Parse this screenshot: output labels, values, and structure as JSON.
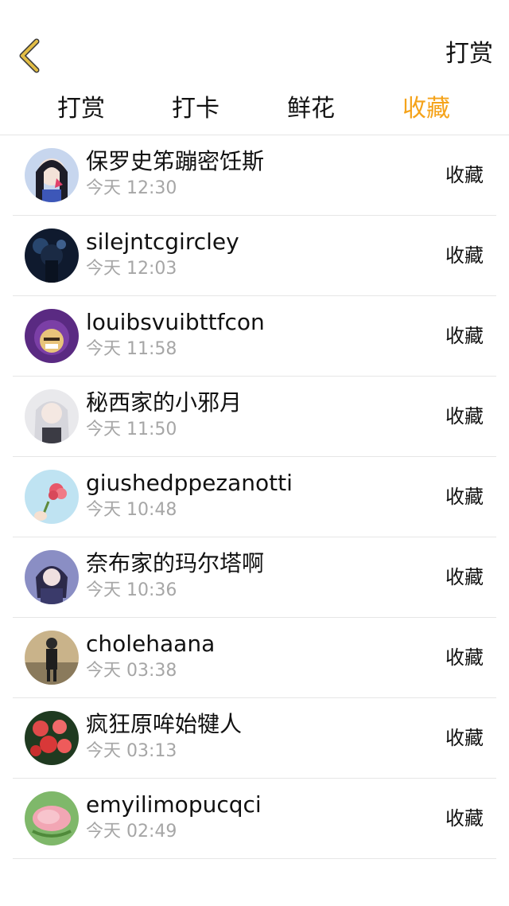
{
  "header": {
    "title": "打赏",
    "back_icon": "chevron-left-icon",
    "back_icon_color": "#d9b23b"
  },
  "tabs": [
    {
      "label": "打赏",
      "active": false
    },
    {
      "label": "打卡",
      "active": false
    },
    {
      "label": "鲜花",
      "active": false
    },
    {
      "label": "收藏",
      "active": true
    }
  ],
  "colors": {
    "active_tab": "#f5a31a",
    "text": "#111111",
    "secondary_text": "#a6a6a6",
    "divider": "#e6e6e6"
  },
  "list": [
    {
      "name": "保罗史笫蹦密饪斯",
      "time": "今天 12:30",
      "action": "收藏"
    },
    {
      "name": "silejntcgircley",
      "time": "今天 12:03",
      "action": "收藏"
    },
    {
      "name": "louibsvuibttfcon",
      "time": "今天 11:58",
      "action": "收藏"
    },
    {
      "name": "秘西家的小邪月",
      "time": "今天 11:50",
      "action": "收藏"
    },
    {
      "name": "giushedppezanotti",
      "time": "今天 10:48",
      "action": "收藏"
    },
    {
      "name": "奈布家的玛尔塔啊",
      "time": "今天 10:36",
      "action": "收藏"
    },
    {
      "name": "cholehaana",
      "time": "今天 03:38",
      "action": "收藏"
    },
    {
      "name": "疯狂原哞始犍人",
      "time": "今天 03:13",
      "action": "收藏"
    },
    {
      "name": "emyilimopucqci",
      "time": "今天 02:49",
      "action": "收藏"
    }
  ]
}
